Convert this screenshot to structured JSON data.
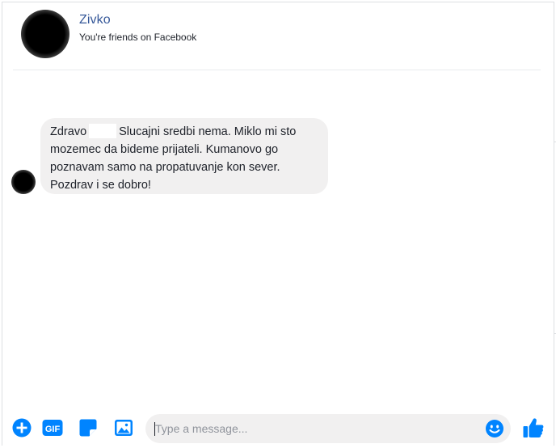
{
  "header": {
    "name": "Zivko",
    "subtitle": "You're friends on Facebook"
  },
  "message": {
    "line1_a": "Zdravo",
    "line1_b": "Slucajni sredbi nema. Miklo mi sto",
    "line2": "mozemec da bideme prijateli. Kumanovo go",
    "line3": "poznavam samo na propatuvanje kon sever.",
    "line4": "Pozdrav i se dobro!"
  },
  "composer": {
    "placeholder": "Type a message...",
    "icons": [
      "plus-circle-icon",
      "gif-icon",
      "sticker-icon",
      "photo-icon",
      "smiley-icon",
      "thumbs-up-icon"
    ]
  },
  "colors": {
    "accent": "#0084ff",
    "name": "#365899",
    "bubble": "#f1f0f0",
    "text": "#1d2129",
    "placeholder": "#90949c",
    "border": "#dddfe2"
  }
}
